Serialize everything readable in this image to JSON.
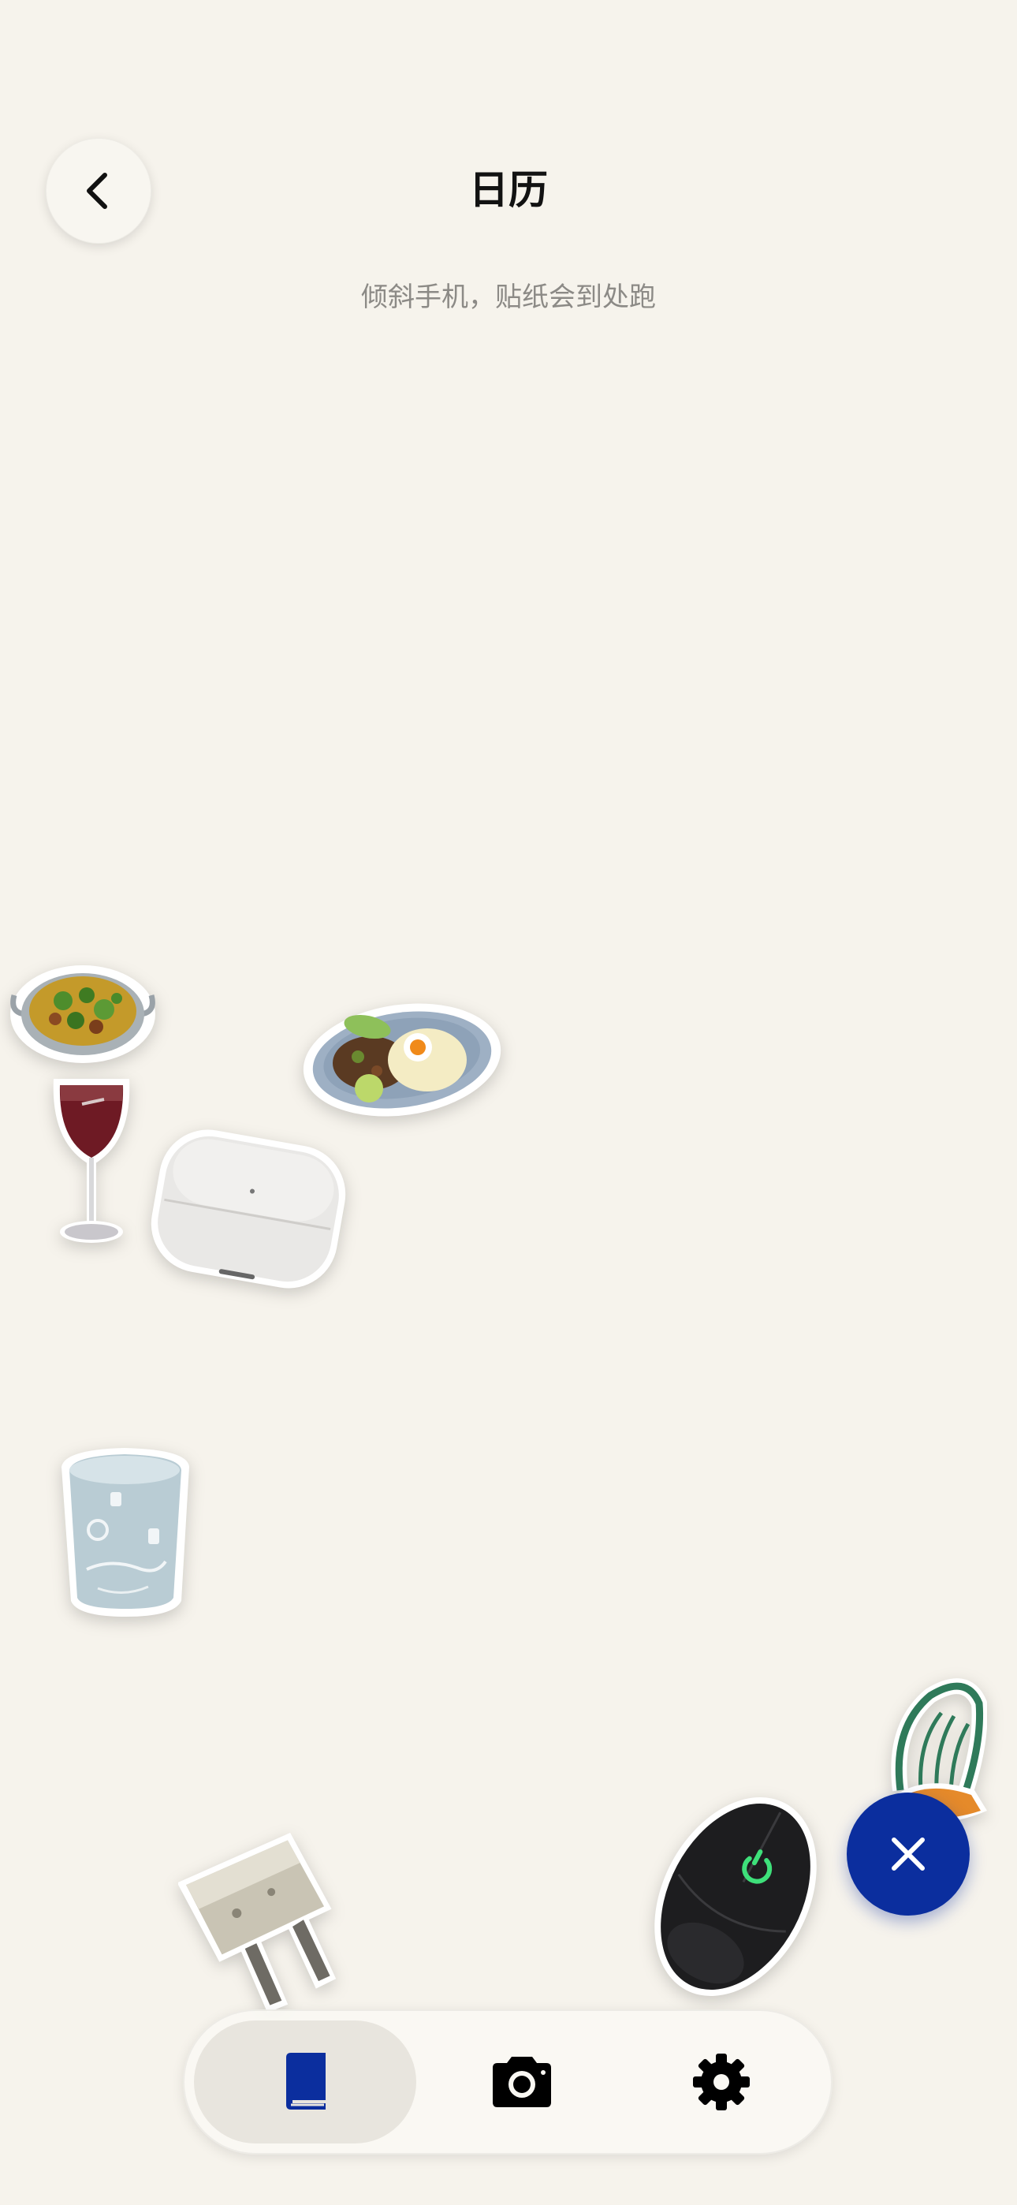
{
  "header": {
    "title": "日历",
    "hint": "倾斜手机，贴纸会到处跑",
    "back_icon": "chevron-left-icon"
  },
  "stickers": [
    {
      "name": "curry-bowl-sticker"
    },
    {
      "name": "rice-plate-sticker"
    },
    {
      "name": "wine-glass-sticker"
    },
    {
      "name": "airpods-case-sticker"
    },
    {
      "name": "glass-cup-sticker"
    },
    {
      "name": "green-chair-sticker"
    },
    {
      "name": "power-plug-sticker"
    },
    {
      "name": "gaming-mouse-sticker"
    }
  ],
  "fab": {
    "icon": "close-icon"
  },
  "tabbar": {
    "tabs": [
      {
        "id": "diary",
        "icon": "book-icon",
        "active": true
      },
      {
        "id": "camera",
        "icon": "camera-icon",
        "active": false
      },
      {
        "id": "settings",
        "icon": "gear-icon",
        "active": false
      }
    ]
  },
  "colors": {
    "background": "#f6f3ec",
    "accent": "#0b2e9e",
    "title": "#121212",
    "hint": "#8c8a86"
  }
}
